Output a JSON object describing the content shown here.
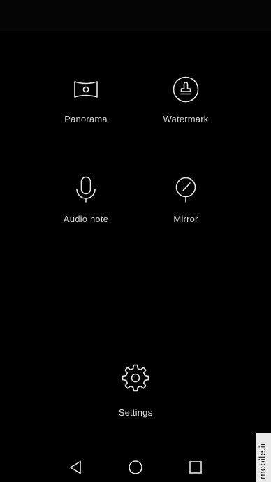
{
  "modes": {
    "panorama": {
      "label": "Panorama",
      "icon": "panorama-icon"
    },
    "watermark": {
      "label": "Watermark",
      "icon": "stamp-icon"
    },
    "audio_note": {
      "label": "Audio note",
      "icon": "microphone-icon"
    },
    "mirror": {
      "label": "Mirror",
      "icon": "mirror-icon"
    }
  },
  "settings": {
    "label": "Settings",
    "icon": "gear-icon"
  },
  "navigation": {
    "back_icon": "triangle-back-icon",
    "home_icon": "circle-home-icon",
    "recents_icon": "square-recents-icon"
  },
  "site_watermark": "mobile.ir",
  "colors": {
    "background": "#000000",
    "icon_stroke": "#e6e6e6",
    "label_text": "#d9d9d9"
  }
}
